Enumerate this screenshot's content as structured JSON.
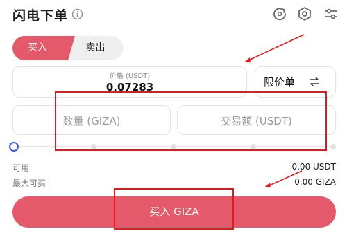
{
  "header": {
    "title": "闪电下单",
    "info_icon": "info-icon",
    "settings_icon": "gear-icon",
    "refresh_icon": "refresh-icon"
  },
  "toggle": {
    "buy_label": "买入",
    "sell_label": "卖出",
    "selected": "buy"
  },
  "price": {
    "label": "价格 (USDT)",
    "value": "0.07283"
  },
  "order_type": {
    "label": "限价单",
    "icon": "swap-icon"
  },
  "quantity": {
    "placeholder": "数量 (GIZA)"
  },
  "amount": {
    "placeholder": "交易额 (USDT)"
  },
  "slider": {
    "value_percent": 0
  },
  "info": {
    "available_label": "可用",
    "available_value": "0.00 USDT",
    "max_buy_label": "最大可买",
    "max_buy_value": "0.00 GIZA"
  },
  "buy_button": {
    "label": "买入 GIZA"
  },
  "colors": {
    "accent_red": "#e45a6a",
    "annotation_red": "#e01b1b",
    "slider_blue": "#3b5bdb"
  }
}
